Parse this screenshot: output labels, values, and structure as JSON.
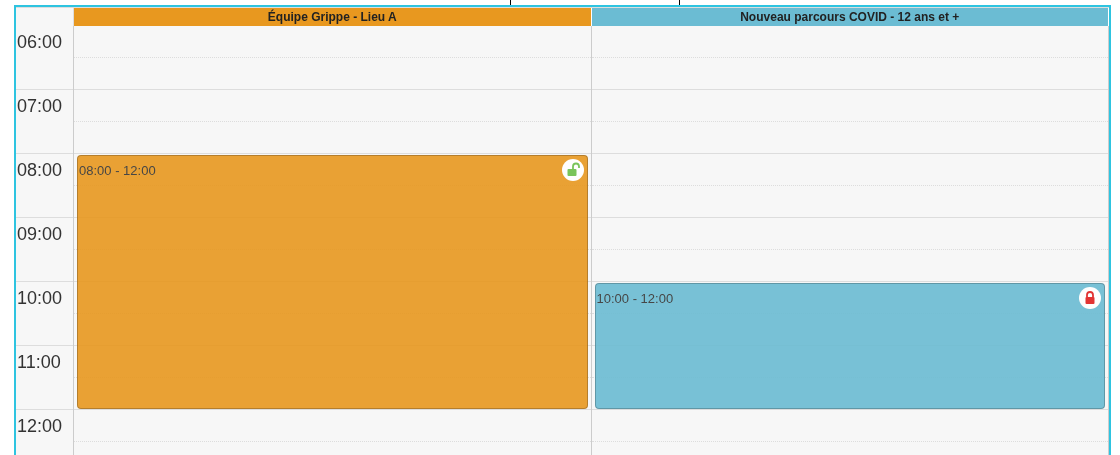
{
  "hours": [
    "06:00",
    "07:00",
    "08:00",
    "09:00",
    "10:00",
    "11:00",
    "12:00"
  ],
  "columns": [
    {
      "title": "Équipe Grippe - Lieu A",
      "color": "#e8981f",
      "events": [
        {
          "time": "08:00 - 12:00",
          "locked": false
        }
      ]
    },
    {
      "title": "Nouveau parcours COVID - 12 ans et +",
      "color": "#6bbcd3",
      "events": [
        {
          "time": "10:00 - 12:00",
          "locked": true
        }
      ]
    }
  ]
}
